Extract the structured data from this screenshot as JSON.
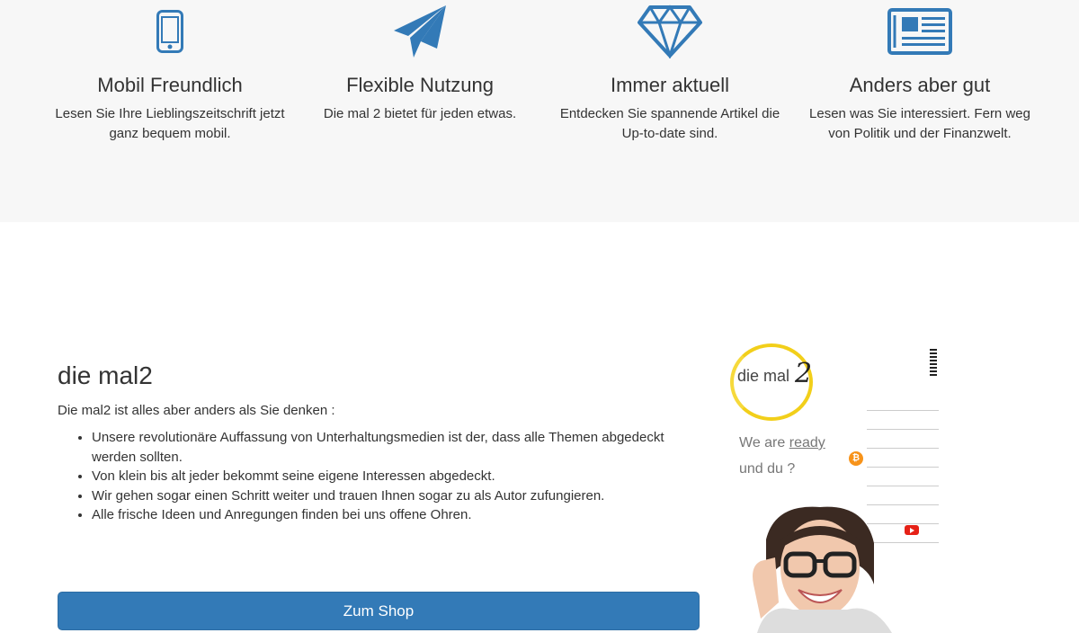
{
  "features": [
    {
      "icon": "mobile-phone-icon",
      "title": "Mobil Freundlich",
      "text": "Lesen Sie Ihre Lieblingszeitschrift jetzt ganz bequem mobil."
    },
    {
      "icon": "paper-plane-icon",
      "title": "Flexible Nutzung",
      "text": "Die mal 2 bietet für jeden etwas."
    },
    {
      "icon": "diamond-icon",
      "title": "Immer aktuell",
      "text": "Entdecken Sie spannende Artikel die Up-to-date sind."
    },
    {
      "icon": "newspaper-icon",
      "title": "Anders aber gut",
      "text": "Lesen was Sie interessiert. Fern weg von Politik und der Finanzwelt."
    }
  ],
  "about": {
    "heading": "die mal2",
    "intro": "Die mal2 ist alles aber anders als Sie denken :",
    "bullets": [
      "Unsere revolutionäre Auffassung von Unterhaltungsmedien ist der, dass alle Themen abgedeckt werden sollten.",
      "Von klein bis alt jeder bekommt seine eigene Interessen abgedeckt.",
      "Wir gehen sogar einen Schritt weiter und trauen Ihnen sogar zu als Autor zufungieren.",
      "Alle frische Ideen und Anregungen finden bei uns offene Ohren."
    ],
    "shop_button": "Zum Shop"
  },
  "promo": {
    "logo_text": "die mal",
    "logo_number": "2",
    "line_prefix": "We are ",
    "line_highlight": "ready",
    "line_2": "und du ?"
  },
  "colors": {
    "accent": "#337ab7",
    "icon": "#337ab7",
    "logo_ring": "#f2cf1a",
    "features_bg": "#f7f7f7"
  }
}
